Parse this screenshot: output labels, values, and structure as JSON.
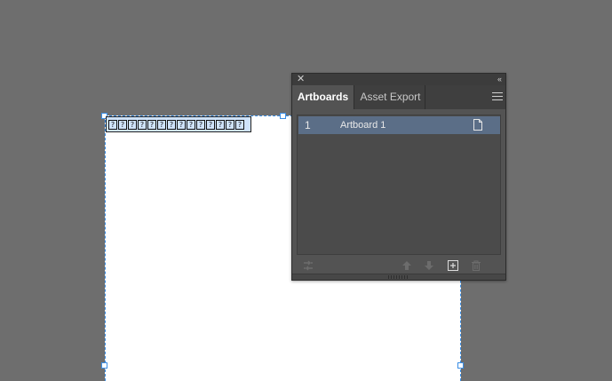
{
  "artboard": {
    "name_glyphs": [
      "?",
      "?",
      "?",
      "?",
      "?",
      "?",
      "?",
      "?",
      "?",
      "?",
      "?",
      "?",
      "?",
      "?"
    ]
  },
  "panel": {
    "close_icon": "close-icon",
    "collapse_label": "‹‹",
    "tabs": [
      {
        "label": "Artboards",
        "active": true
      },
      {
        "label": "Asset Export",
        "active": false
      }
    ],
    "rows": [
      {
        "number": "1",
        "name": "Artboard 1"
      }
    ],
    "footer_icons": [
      "rearrange-icon",
      "move-up-icon",
      "move-down-icon",
      "new-artboard-icon",
      "delete-icon"
    ]
  },
  "colors": {
    "canvas": "#6e6e6e",
    "panel_bg": "#535353",
    "selected_row": "#5b6e87",
    "selection_accent": "#3b8ee5"
  }
}
